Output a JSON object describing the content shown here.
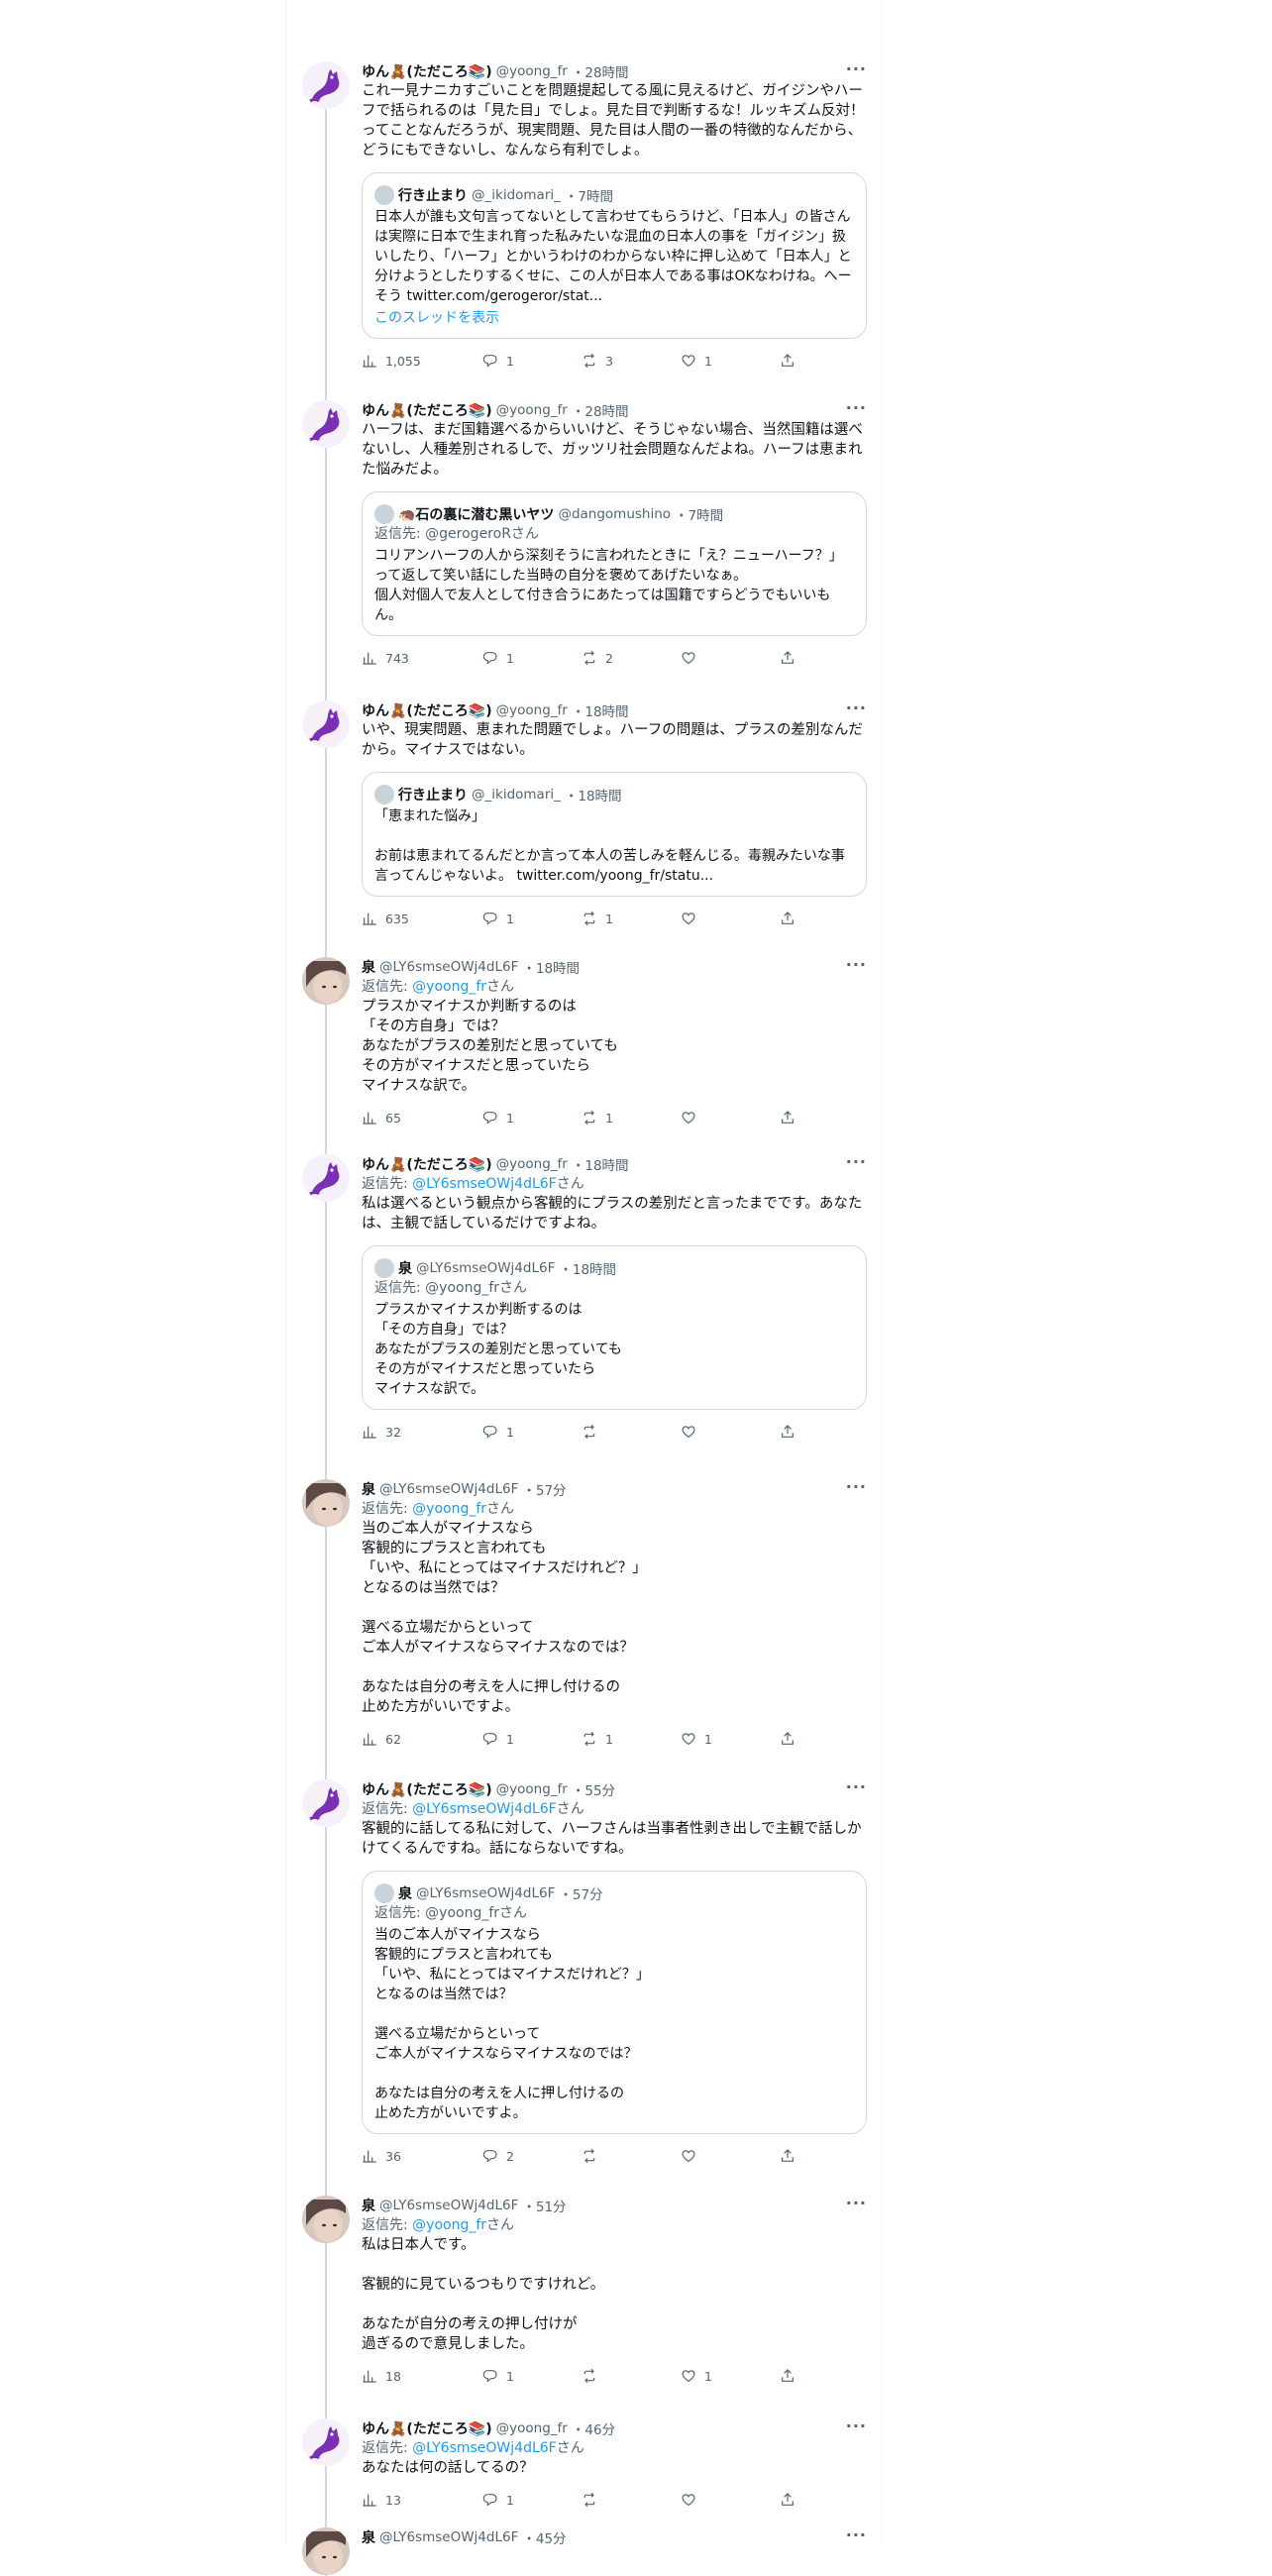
{
  "tweets": [
    {
      "avatar": "purple-cat-avatar",
      "name": "ゆん🧸(ただころ📚)",
      "handle": "@yoong_fr",
      "time": "28時間",
      "reply_to": null,
      "text": "これ一見ナニカすごいことを問題提起してる風に見えるけど、ガイジンやハーフで括られるのは「見た目」でしょ。見た目で判断するな！ルッキズム反対！ってことなんだろうが、現実問題、見た目は人間の一番の特徴的なんだから、どうにもできないし、なんなら有利でしょ。",
      "quote": {
        "name": "行き止まり",
        "handle": "@_ikidomari_",
        "time": "7時間",
        "reply_to": null,
        "text": "日本人が誰も文句言ってないとして言わせてもらうけど、「日本人」の皆さんは実際に日本で生まれ育った私みたいな混血の日本人の事を「ガイジン」扱いしたり、「ハーフ」とかいうわけのわからない枠に押し込めて「日本人」と分けようとしたりするくせに、この人が日本人である事はOKなわけね。へーそう twitter.com/gerogeror/stat...",
        "show_thread": "このスレッドを表示"
      },
      "stats": {
        "views": "1,055",
        "replies": "1",
        "retweets": "3",
        "likes": "1"
      }
    },
    {
      "avatar": "purple-cat-avatar",
      "name": "ゆん🧸(ただころ📚)",
      "handle": "@yoong_fr",
      "time": "28時間",
      "reply_to": null,
      "text": "ハーフは、まだ国籍選べるからいいけど、そうじゃない場合、当然国籍は選べないし、人種差別されるしで、ガッツリ社会問題なんだよね。ハーフは恵まれた悩みだよ。",
      "quote": {
        "name": "🦔石の裏に潜む黒いヤツ",
        "handle": "@dangomushino",
        "time": "7時間",
        "reply_to": "返信先: @gerogeroRさん",
        "text": "コリアンハーフの人から深刻そうに言われたときに「え？ニューハーフ？」って返して笑い話にした当時の自分を褒めてあげたいなぁ。\n個人対個人で友人として付き合うにあたっては国籍ですらどうでもいいもん。",
        "show_thread": null
      },
      "stats": {
        "views": "743",
        "replies": "1",
        "retweets": "2",
        "likes": ""
      }
    },
    {
      "avatar": "purple-cat-avatar",
      "name": "ゆん🧸(ただころ📚)",
      "handle": "@yoong_fr",
      "time": "18時間",
      "reply_to": null,
      "text": "いや、現実問題、恵まれた問題でしょ。ハーフの問題は、プラスの差別なんだから。マイナスではない。",
      "quote": {
        "name": "行き止まり",
        "handle": "@_ikidomari_",
        "time": "18時間",
        "reply_to": null,
        "text": "「恵まれた悩み」\n\nお前は恵まれてるんだとか言って本人の苦しみを軽んじる。毒親みたいな事言ってんじゃないよ。 twitter.com/yoong_fr/statu...",
        "show_thread": null
      },
      "stats": {
        "views": "635",
        "replies": "1",
        "retweets": "1",
        "likes": ""
      }
    },
    {
      "avatar": "photo-avatar",
      "name": "泉",
      "handle": "@LY6smseOWj4dL6F",
      "time": "18時間",
      "reply_to": "@yoong_fr",
      "text": "プラスかマイナスか判断するのは\n「その方自身」では？\nあなたがプラスの差別だと思っていても\nその方がマイナスだと思っていたら\nマイナスな訳で。",
      "quote": null,
      "stats": {
        "views": "65",
        "replies": "1",
        "retweets": "1",
        "likes": ""
      }
    },
    {
      "avatar": "purple-cat-avatar",
      "name": "ゆん🧸(ただころ📚)",
      "handle": "@yoong_fr",
      "time": "18時間",
      "reply_to": "@LY6smseOWj4dL6F",
      "text": "私は選べるという観点から客観的にプラスの差別だと言ったまでです。あなたは、主観で話しているだけですよね。",
      "quote": {
        "name": "泉",
        "handle": "@LY6smseOWj4dL6F",
        "time": "18時間",
        "reply_to": "返信先: @yoong_frさん",
        "text": "プラスかマイナスか判断するのは\n「その方自身」では？\nあなたがプラスの差別だと思っていても\nその方がマイナスだと思っていたら\nマイナスな訳で。",
        "show_thread": null
      },
      "stats": {
        "views": "32",
        "replies": "1",
        "retweets": "",
        "likes": ""
      }
    },
    {
      "avatar": "photo-avatar",
      "name": "泉",
      "handle": "@LY6smseOWj4dL6F",
      "time": "57分",
      "reply_to": "@yoong_fr",
      "text": "当のご本人がマイナスなら\n客観的にプラスと言われても\n「いや、私にとってはマイナスだけれど？」\nとなるのは当然では？\n\n選べる立場だからといって\nご本人がマイナスならマイナスなのでは？\n\nあなたは自分の考えを人に押し付けるの\n止めた方がいいですよ。",
      "quote": null,
      "stats": {
        "views": "62",
        "replies": "1",
        "retweets": "1",
        "likes": "1"
      }
    },
    {
      "avatar": "purple-cat-avatar",
      "name": "ゆん🧸(ただころ📚)",
      "handle": "@yoong_fr",
      "time": "55分",
      "reply_to": "@LY6smseOWj4dL6F",
      "text": "客観的に話してる私に対して、ハーフさんは当事者性剥き出しで主観で話しかけてくるんですね。話にならないですね。",
      "quote": {
        "name": "泉",
        "handle": "@LY6smseOWj4dL6F",
        "time": "57分",
        "reply_to": "返信先: @yoong_frさん",
        "text": "当のご本人がマイナスなら\n客観的にプラスと言われても\n「いや、私にとってはマイナスだけれど？」\nとなるのは当然では？\n\n選べる立場だからといって\nご本人がマイナスならマイナスなのでは？\n\nあなたは自分の考えを人に押し付けるの\n止めた方がいいですよ。",
        "show_thread": null
      },
      "stats": {
        "views": "36",
        "replies": "2",
        "retweets": "",
        "likes": ""
      }
    },
    {
      "avatar": "photo-avatar",
      "name": "泉",
      "handle": "@LY6smseOWj4dL6F",
      "time": "51分",
      "reply_to": "@yoong_fr",
      "text": "私は日本人です。\n\n客観的に見ているつもりですけれど。\n\nあなたが自分の考えの押し付けが\n過ぎるので意見しました。",
      "quote": null,
      "stats": {
        "views": "18",
        "replies": "1",
        "retweets": "",
        "likes": "1"
      }
    },
    {
      "avatar": "purple-cat-avatar",
      "name": "ゆん🧸(ただころ📚)",
      "handle": "@yoong_fr",
      "time": "46分",
      "reply_to": "@LY6smseOWj4dL6F",
      "text": "あなたは何の話してるの？",
      "quote": null,
      "stats": {
        "views": "13",
        "replies": "1",
        "retweets": "",
        "likes": ""
      }
    },
    {
      "avatar": "photo-avatar",
      "name": "泉",
      "handle": "@LY6smseOWj4dL6F",
      "time": "45分",
      "reply_to": null,
      "text": "",
      "quote": null,
      "stats": null
    }
  ],
  "labels": {
    "reply_prefix": "返信先: ",
    "reply_suffix": "さん",
    "more": "···",
    "dot": "・"
  },
  "colors": {
    "link": "#1d9bf0",
    "muted": "#536471",
    "border": "#cfd9de",
    "avatar_purple": "#7b2fb5"
  }
}
